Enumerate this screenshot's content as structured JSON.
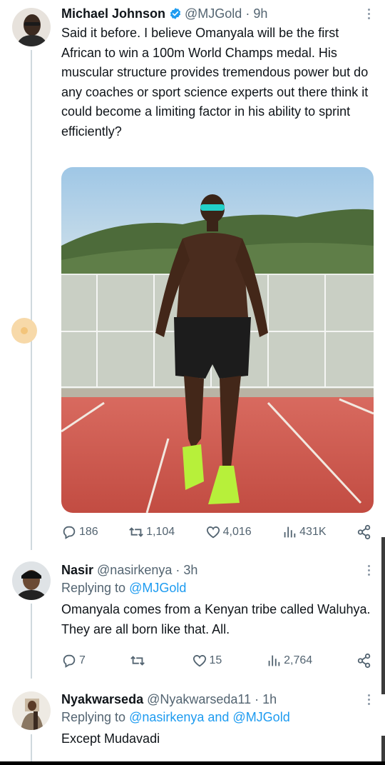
{
  "tweets": [
    {
      "name": "Michael Johnson",
      "handle": "@MJGold",
      "time": "· 9h",
      "verified": true,
      "text": "Said it before. I believe Omanyala will be the first African to win a 100m World Champs medal. His muscular structure provides tremendous power but do any coaches or sport science experts out there think it could become a limiting factor in his ability to sprint efficiently?",
      "stats": {
        "replies": "186",
        "retweets": "1,104",
        "likes": "4,016",
        "views": "431K"
      }
    },
    {
      "name": "Nasir",
      "handle": "@nasirkenya",
      "time": "· 3h",
      "reply_prefix": "Replying to ",
      "reply_to": "@MJGold",
      "text": "Omanyala comes from a Kenyan tribe called Waluhya. They are all born like that. All.",
      "stats": {
        "replies": "7",
        "retweets": "",
        "likes": "15",
        "views": "2,764"
      }
    },
    {
      "name": "Nyakwarseda",
      "handle": "@Nyakwarseda11",
      "time": "· 1h",
      "reply_prefix": "Replying to ",
      "reply_to": "@nasirkenya and @MJGold",
      "text": "Except Mudavadi"
    }
  ],
  "icons": [
    "reply-icon",
    "retweet-icon",
    "like-icon",
    "views-icon",
    "share-icon",
    "more-icon",
    "verified-icon"
  ],
  "colors": {
    "accent": "#1d9bf0",
    "muted": "#536471",
    "text": "#0f1419",
    "track": "#c4524a"
  }
}
